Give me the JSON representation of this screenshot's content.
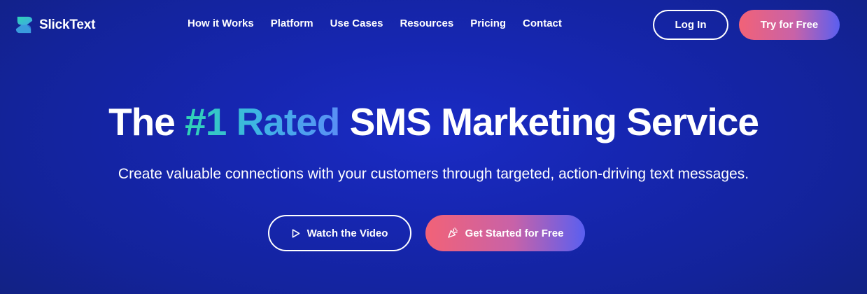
{
  "brand": {
    "name": "SlickText",
    "logo_icon": "slicktext-logo-icon",
    "logo_colors": [
      "#2fd3b4",
      "#3fa8e6"
    ]
  },
  "nav": {
    "items": [
      {
        "label": "How it Works"
      },
      {
        "label": "Platform"
      },
      {
        "label": "Use Cases"
      },
      {
        "label": "Resources"
      },
      {
        "label": "Pricing"
      },
      {
        "label": "Contact"
      }
    ]
  },
  "header_actions": {
    "login_label": "Log In",
    "try_label": "Try for Free"
  },
  "hero": {
    "title_prefix": "The ",
    "title_accent": "#1 Rated",
    "title_suffix": " SMS Marketing Service",
    "subtitle": "Create valuable connections with your customers through targeted, action-driving text messages.",
    "video_button_label": "Watch the Video",
    "video_button_icon": "play-icon",
    "start_button_label": "Get Started for Free",
    "start_button_icon": "party-popper-icon"
  },
  "colors": {
    "background": "#1626b0",
    "accent_gradient_start": "#f26277",
    "accent_gradient_end": "#5a5ff0",
    "title_accent_start": "#2fd3b4",
    "title_accent_end": "#5a8ff5"
  }
}
